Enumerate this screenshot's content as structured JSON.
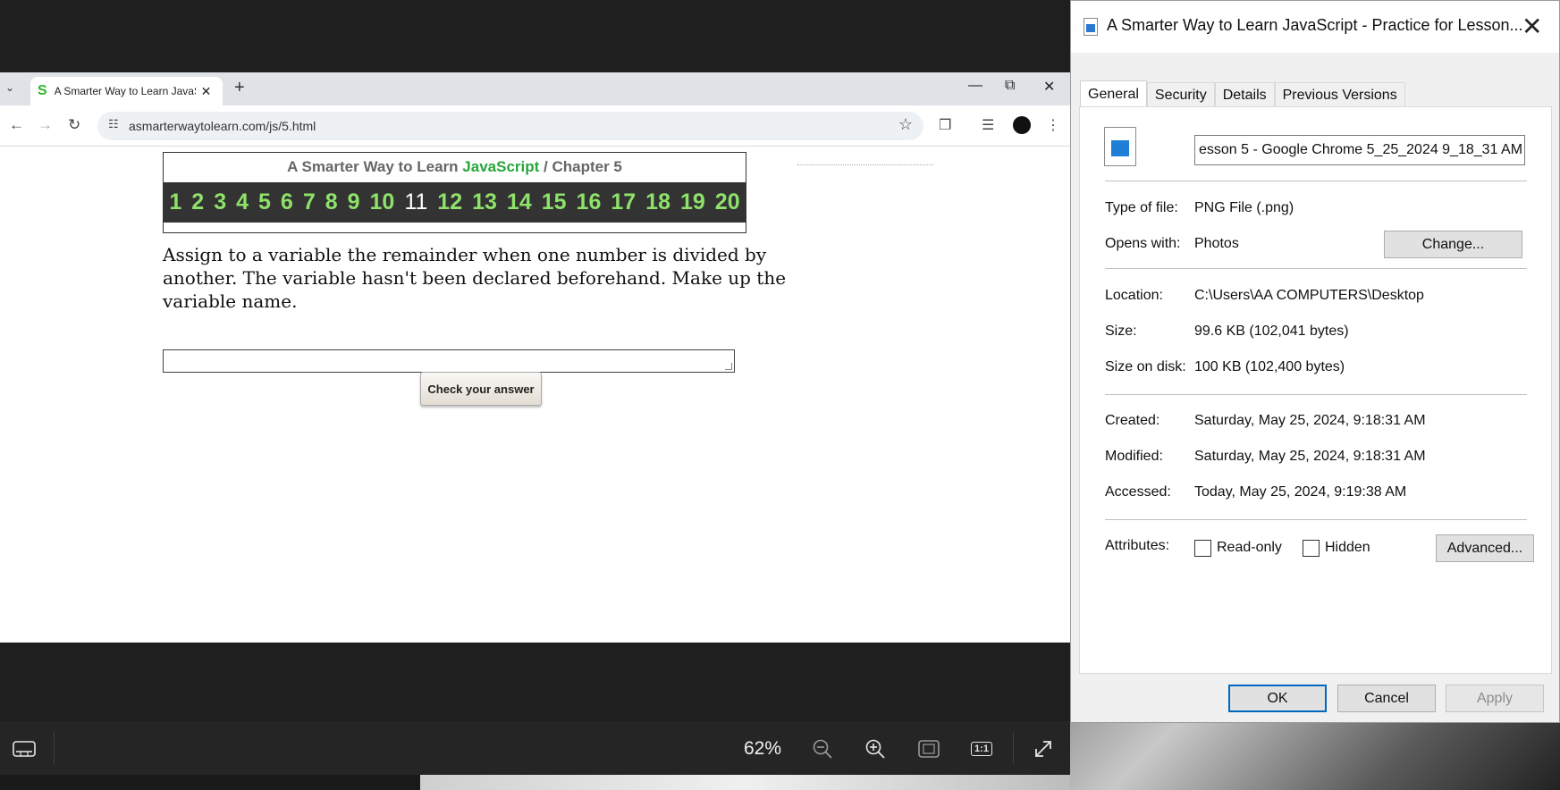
{
  "viewer": {
    "zoom": "62%",
    "icons": [
      "filmstrip-icon",
      "zoom-out-icon",
      "zoom-in-icon",
      "fit-to-window-icon",
      "actual-size-icon",
      "fullscreen-icon"
    ],
    "actual_size_label": "1:1"
  },
  "browser": {
    "tab_title": "A Smarter Way to Learn JavaScript",
    "favicon": "S",
    "url": "asmarterwaytolearn.com/js/5.html"
  },
  "page": {
    "header_prefix": "A Smarter Way to Learn ",
    "header_brand": "JavaScript",
    "header_suffix": "  /  Chapter 5",
    "exercise_numbers": [
      "1",
      "2",
      "3",
      "4",
      "5",
      "6",
      "7",
      "8",
      "9",
      "10",
      "11",
      "12",
      "13",
      "14",
      "15",
      "16",
      "17",
      "18",
      "19",
      "20"
    ],
    "current_exercise": "11",
    "question": "Assign to a variable the remainder when one number is divided by another. The variable hasn't been declared beforehand. Make up the variable name.",
    "answer_value": "",
    "check_button": "Check your answer"
  },
  "dialog": {
    "title": "A Smarter Way to Learn JavaScript - Practice for Lesson...",
    "tabs": [
      "General",
      "Security",
      "Details",
      "Previous Versions"
    ],
    "active_tab": "General",
    "filename": "esson 5 - Google Chrome 5_25_2024 9_18_31 AM",
    "type_label": "Type of file:",
    "type_value": "PNG File (.png)",
    "opens_label": "Opens with:",
    "opens_value": "Photos",
    "change_button": "Change...",
    "location_label": "Location:",
    "location_value": "C:\\Users\\AA COMPUTERS\\Desktop",
    "size_label": "Size:",
    "size_value": "99.6 KB (102,041 bytes)",
    "size_disk_label": "Size on disk:",
    "size_disk_value": "100 KB (102,400 bytes)",
    "created_label": "Created:",
    "created_value": "Saturday, May 25, 2024, 9:18:31 AM",
    "modified_label": "Modified:",
    "modified_value": "Saturday, May 25, 2024, 9:18:31 AM",
    "accessed_label": "Accessed:",
    "accessed_value": "Today, May 25, 2024, 9:19:38 AM",
    "attributes_label": "Attributes:",
    "readonly_label": "Read-only",
    "hidden_label": "Hidden",
    "advanced_button": "Advanced...",
    "ok_button": "OK",
    "cancel_button": "Cancel",
    "apply_button": "Apply"
  }
}
